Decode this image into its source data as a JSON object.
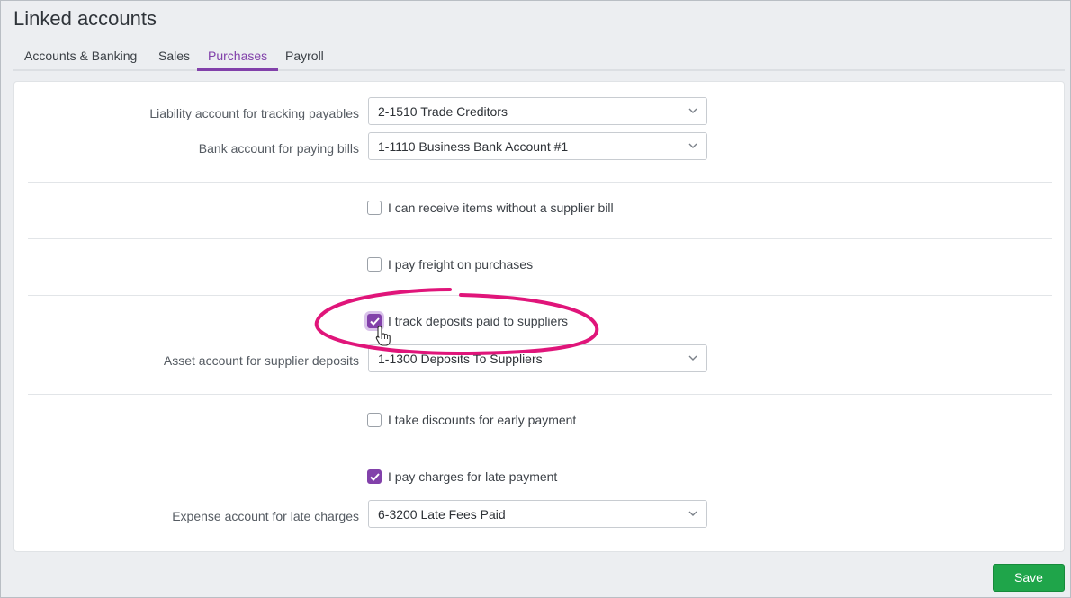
{
  "page": {
    "title": "Linked accounts"
  },
  "tabs": [
    {
      "label": "Accounts & Banking",
      "active": false
    },
    {
      "label": "Sales",
      "active": false
    },
    {
      "label": "Purchases",
      "active": true
    },
    {
      "label": "Payroll",
      "active": false
    }
  ],
  "fields": {
    "liability": {
      "label": "Liability account for tracking payables",
      "value": "2-1510 Trade Creditors"
    },
    "bank": {
      "label": "Bank account for paying bills",
      "value": "1-1110 Business Bank Account #1"
    },
    "receive_without_bill": {
      "label": "I can receive items without a supplier bill",
      "checked": false
    },
    "pay_freight": {
      "label": "I pay freight on purchases",
      "checked": false
    },
    "track_deposits": {
      "label": "I track deposits paid to suppliers",
      "checked": true
    },
    "asset_deposits": {
      "label": "Asset account for supplier deposits",
      "value": "1-1300 Deposits To Suppliers"
    },
    "early_discounts": {
      "label": "I take discounts for early payment",
      "checked": false
    },
    "late_charges": {
      "label": "I pay charges for late payment",
      "checked": true
    },
    "expense_late": {
      "label": "Expense account for late charges",
      "value": "6-3200 Late Fees Paid"
    }
  },
  "actions": {
    "save_label": "Save"
  },
  "colors": {
    "accent": "#8241aa",
    "save": "#1fa54a",
    "annotation": "#e0157a"
  },
  "icons": {
    "caret": "chevron-down-icon",
    "check": "checkmark-icon",
    "cursor": "hand-pointer-icon"
  }
}
